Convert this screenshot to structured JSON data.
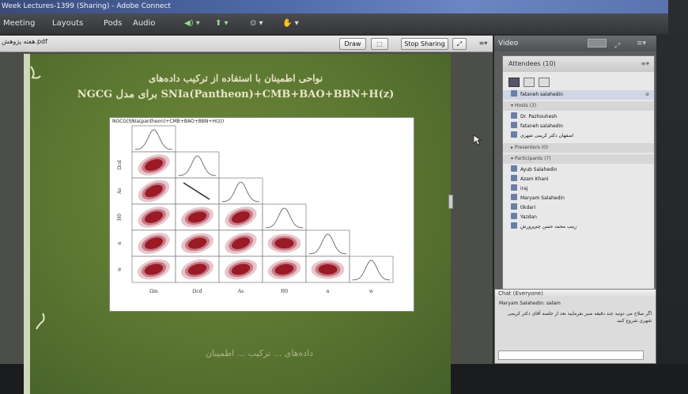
{
  "window": {
    "title": "Week Lectures-1399 (Sharing) - Adobe Connect"
  },
  "menu": {
    "items": [
      "Meeting",
      "Layouts",
      "Pods",
      "Audio"
    ]
  },
  "share": {
    "file_title": "هفته پژوهش.pdf",
    "draw_label": "Draw",
    "stop_label": "Stop Sharing"
  },
  "slide": {
    "title_line1": "نواحی اطمینان با استفاده از ترکیب داده‌های",
    "title_line2": "NGCG برای مدل SNIa(Pantheon)+CMB+BAO+BBN+H(z)",
    "figure_title": "NGCG(SNIa(pantheon)+CMB+BAO+BBN+H(z))",
    "bottom_text": "داده‌های ... ترکیب ... اطمینان"
  },
  "right_panel": {
    "video_label": "Video",
    "attendees_label": "Attendees",
    "attendees_count": "(10)",
    "current_user": "fataneh salahedin",
    "hosts_label": "Hosts (3)",
    "hosts": [
      "Dr. Pazhouhesh",
      "fataneh salahedin",
      "اصفهان دکتر کریمی شهری"
    ],
    "presenters_label": "Presenters (0)",
    "participants_label": "Participants (7)",
    "participants": [
      "Ayub Salahedin",
      "Azam Khani",
      "iraj",
      "Maryam Salahedin",
      "tikdari",
      "Yazdan",
      "زینب محمد حسن چم‌پرورش"
    ]
  },
  "chat": {
    "label": "Chat",
    "scope": "(Everyone)",
    "messages": [
      {
        "author": "Maryam Salahedin",
        "text": "salam"
      },
      {
        "author": "",
        "text": "اگر صلاح می دونید چند دقیقه صبر بفرمایید بعد از جلسه آقای دکتر کریمی شهری شروع کنید"
      }
    ]
  },
  "chart_data": {
    "type": "corner-plot",
    "title": "NGCG(SNIa(pantheon)+CMB+BAO+BBN+H(z))",
    "parameters": [
      "Ω_m",
      "Ω_cd",
      "A_s",
      "H_0",
      "α",
      "w"
    ],
    "axis_labels_x": [
      "Ωm",
      "Ωcd",
      "As",
      "H0",
      "α",
      "w"
    ],
    "axis_labels_y": [
      "Ωcd",
      "As",
      "H0",
      "α",
      "w"
    ],
    "colors": {
      "contour_inner": "#9a1a26",
      "contour_mid": "#c87a86",
      "contour_outer": "#e8c6cc"
    }
  }
}
